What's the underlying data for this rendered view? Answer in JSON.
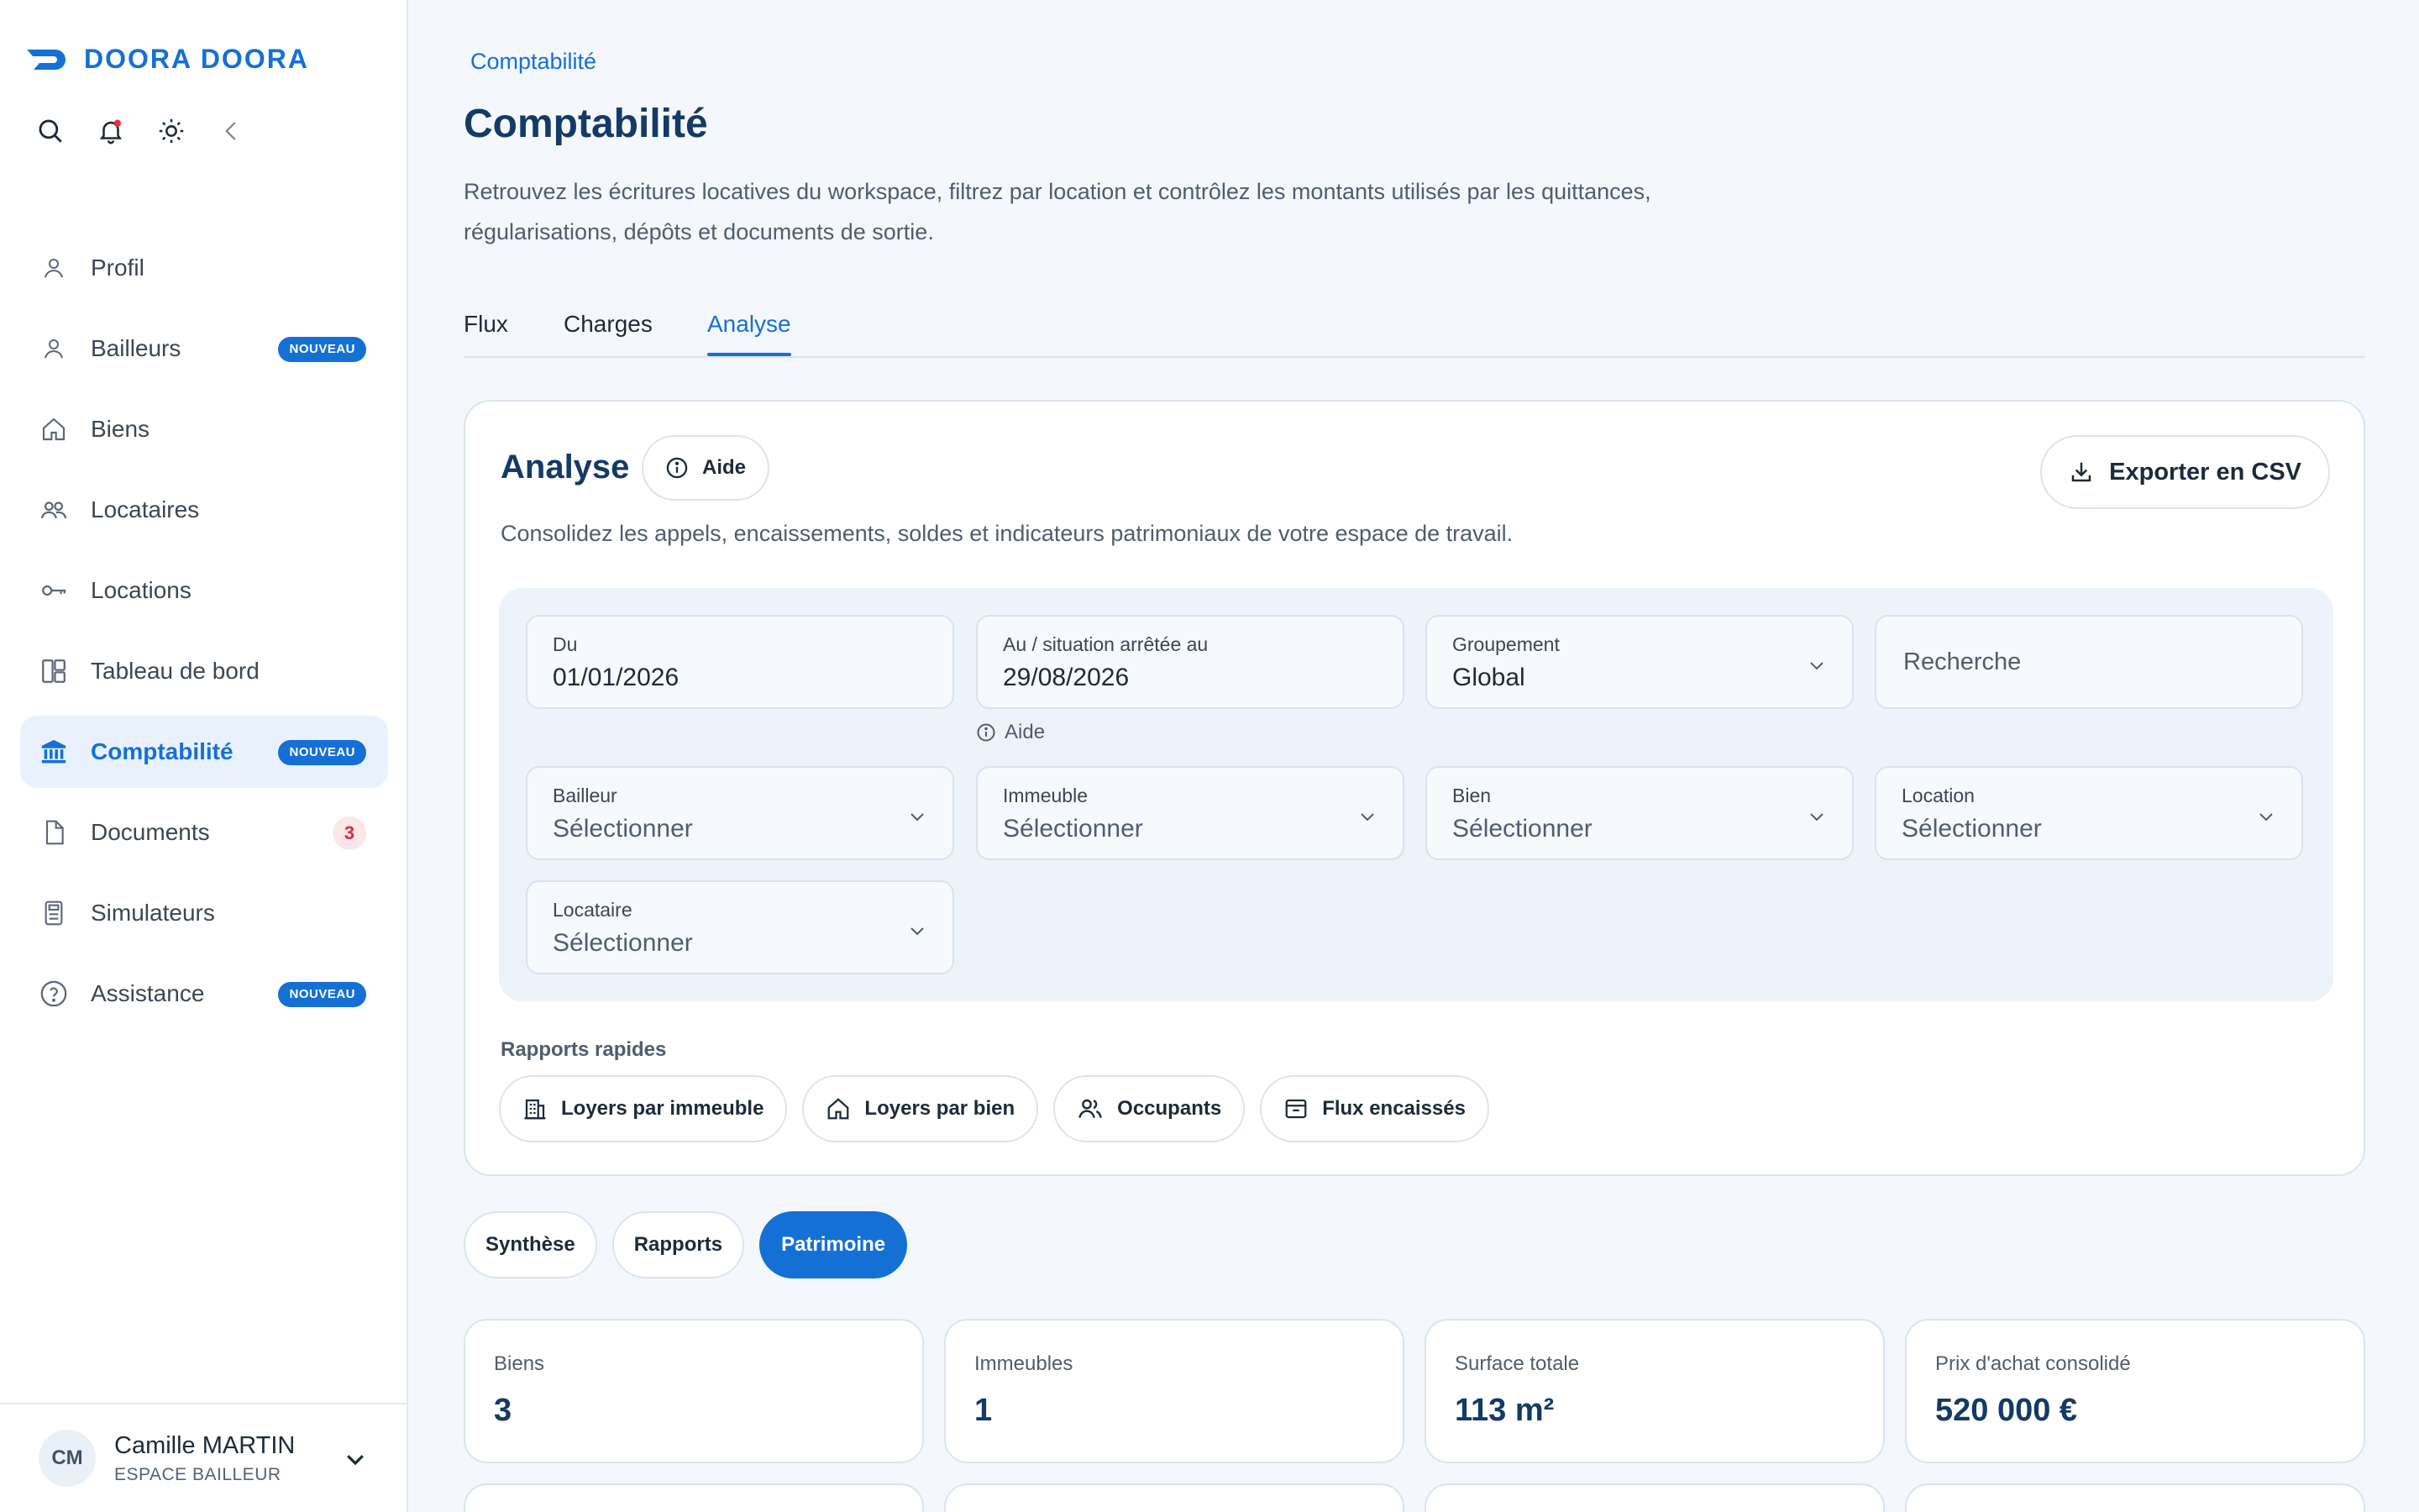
{
  "brand": {
    "name": "DOORA DOORA",
    "accent": "#1570d6"
  },
  "sidebar": {
    "toolbar": [
      {
        "icon": "search-icon"
      },
      {
        "icon": "bell-icon",
        "has_dot": true
      },
      {
        "icon": "sun-icon"
      },
      {
        "icon": "chevron-left-icon"
      }
    ],
    "items": [
      {
        "label": "Profil",
        "icon": "user-icon"
      },
      {
        "label": "Bailleurs",
        "icon": "user-icon",
        "badge": "NOUVEAU"
      },
      {
        "label": "Biens",
        "icon": "home-icon"
      },
      {
        "label": "Locataires",
        "icon": "users-icon"
      },
      {
        "label": "Locations",
        "icon": "key-icon"
      },
      {
        "label": "Tableau de bord",
        "icon": "dashboard-icon"
      },
      {
        "label": "Comptabilité",
        "icon": "bank-icon",
        "badge": "NOUVEAU",
        "active": true
      },
      {
        "label": "Documents",
        "icon": "document-icon",
        "count": "3"
      },
      {
        "label": "Simulateurs",
        "icon": "calculator-icon"
      },
      {
        "label": "Assistance",
        "icon": "help-circle-icon",
        "badge": "NOUVEAU"
      }
    ],
    "user": {
      "initials": "CM",
      "name": "Camille MARTIN",
      "role": "ESPACE BAILLEUR"
    }
  },
  "header": {
    "breadcrumb": "Comptabilité",
    "title": "Comptabilité",
    "description_line1": "Retrouvez les écritures locatives du workspace, filtrez par location et contrôlez les montants utilisés par les quittances,",
    "description_line2": "régularisations, dépôts et documents de sortie."
  },
  "tabs": [
    {
      "label": "Flux"
    },
    {
      "label": "Charges"
    },
    {
      "label": "Analyse",
      "active": true
    }
  ],
  "analyse": {
    "title": "Analyse",
    "help_label": "Aide",
    "export_label": "Exporter en CSV",
    "description": "Consolidez les appels, encaissements, soldes et indicateurs patrimoniaux de votre espace de travail.",
    "filters": {
      "from": {
        "label": "Du",
        "value": "01/01/2026"
      },
      "to": {
        "label": "Au / situation arrêtée au",
        "value": "29/08/2026",
        "help": "Aide"
      },
      "grouping": {
        "label": "Groupement",
        "value": "Global"
      },
      "search": {
        "placeholder": "Recherche"
      },
      "landlord": {
        "label": "Bailleur",
        "value": "Sélectionner"
      },
      "building": {
        "label": "Immeuble",
        "value": "Sélectionner"
      },
      "property": {
        "label": "Bien",
        "value": "Sélectionner"
      },
      "rental": {
        "label": "Location",
        "value": "Sélectionner"
      },
      "tenant": {
        "label": "Locataire",
        "value": "Sélectionner"
      }
    },
    "quick_reports": {
      "label": "Rapports rapides",
      "items": [
        {
          "label": "Loyers par immeuble",
          "icon": "building-icon"
        },
        {
          "label": "Loyers par bien",
          "icon": "home-icon"
        },
        {
          "label": "Occupants",
          "icon": "users-icon"
        },
        {
          "label": "Flux encaissés",
          "icon": "inbox-icon"
        }
      ]
    }
  },
  "views": [
    {
      "label": "Synthèse"
    },
    {
      "label": "Rapports"
    },
    {
      "label": "Patrimoine",
      "active": true
    }
  ],
  "stats": [
    {
      "label": "Biens",
      "value": "3"
    },
    {
      "label": "Immeubles",
      "value": "1"
    },
    {
      "label": "Surface totale",
      "value": "113 m²"
    },
    {
      "label": "Prix d'achat consolidé",
      "value": "520 000 €"
    }
  ]
}
